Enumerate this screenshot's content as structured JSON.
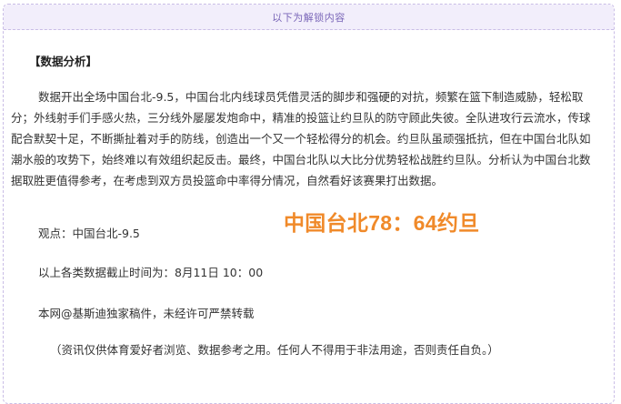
{
  "unlock": {
    "header_label": "以下为解锁内容"
  },
  "article": {
    "section_title": "【数据分析】",
    "analysis_paragraph": "数据开出全场中国台北-9.5，中国台北内线球员凭借灵活的脚步和强硬的对抗，频繁在篮下制造威胁，轻松取分；外线射手们手感火热，三分线外屡屡发炮命中，精准的投篮让约旦队的防守顾此失彼。全队进攻行云流水，传球配合默契十足，不断撕扯着对手的防线，创造出一个又一个轻松得分的机会。约旦队虽顽强抵抗，但在中国台北队如潮水般的攻势下，始终难以有效组织起反击。最终，中国台北队以大比分优势轻松战胜约旦队。分析认为中国台北数据取胜更值得参考，在考虑到双方员投篮命中率得分情况，自然看好该赛果打出数据。",
    "viewpoint": "观点：中国台北-9.5",
    "data_cutoff": "以上各类数据截止时间为：8月11日 10：00",
    "copyright": "本网@基斯迪独家稿件，未经许可严禁转载",
    "disclaimer": "（资讯仅供体育爱好者浏览、数据参考之用。任何人不得用于非法用途，否则责任自负。）"
  },
  "score_overlay": {
    "text": "中国台北78：64约旦",
    "color": "#f08a2a"
  }
}
